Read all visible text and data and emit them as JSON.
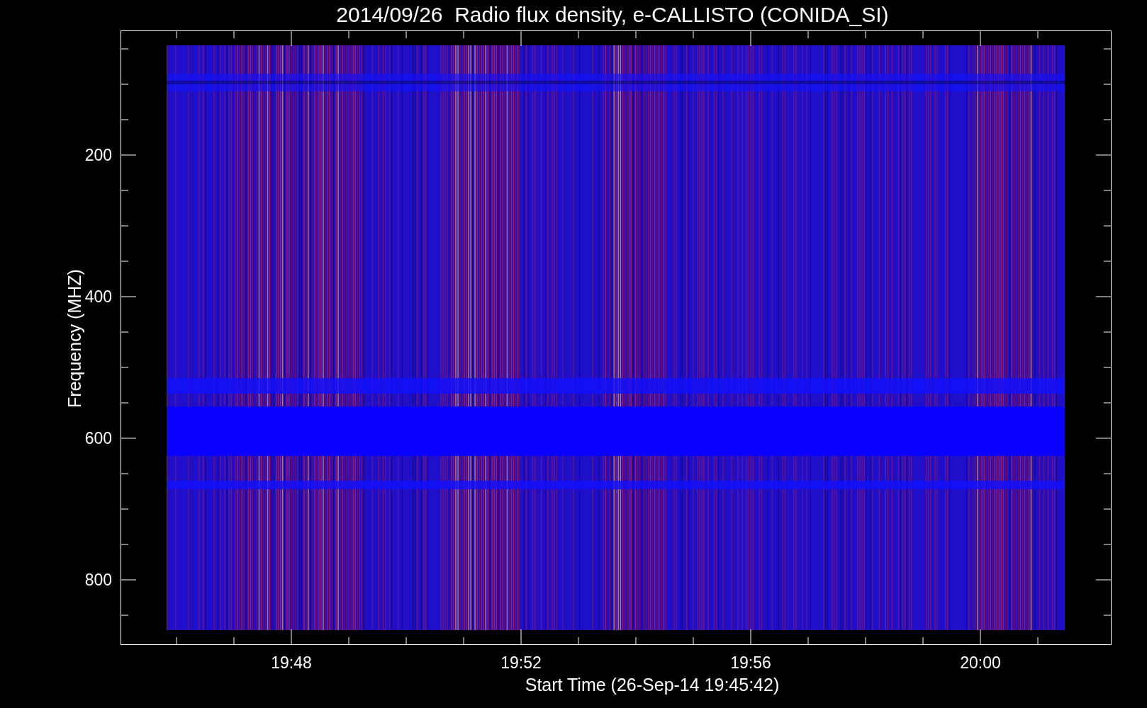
{
  "title": "2014/09/26  Radio flux density, e-CALLISTO (CONIDA_SI)",
  "y_axis": {
    "label": "Frequency (MHZ)",
    "tick_labels": [
      "200",
      "400",
      "600",
      "800"
    ]
  },
  "x_axis": {
    "label": "Start Time (26-Sep-14 19:45:42)",
    "tick_labels": [
      "19:48",
      "19:52",
      "19:56",
      "20:00"
    ]
  }
}
